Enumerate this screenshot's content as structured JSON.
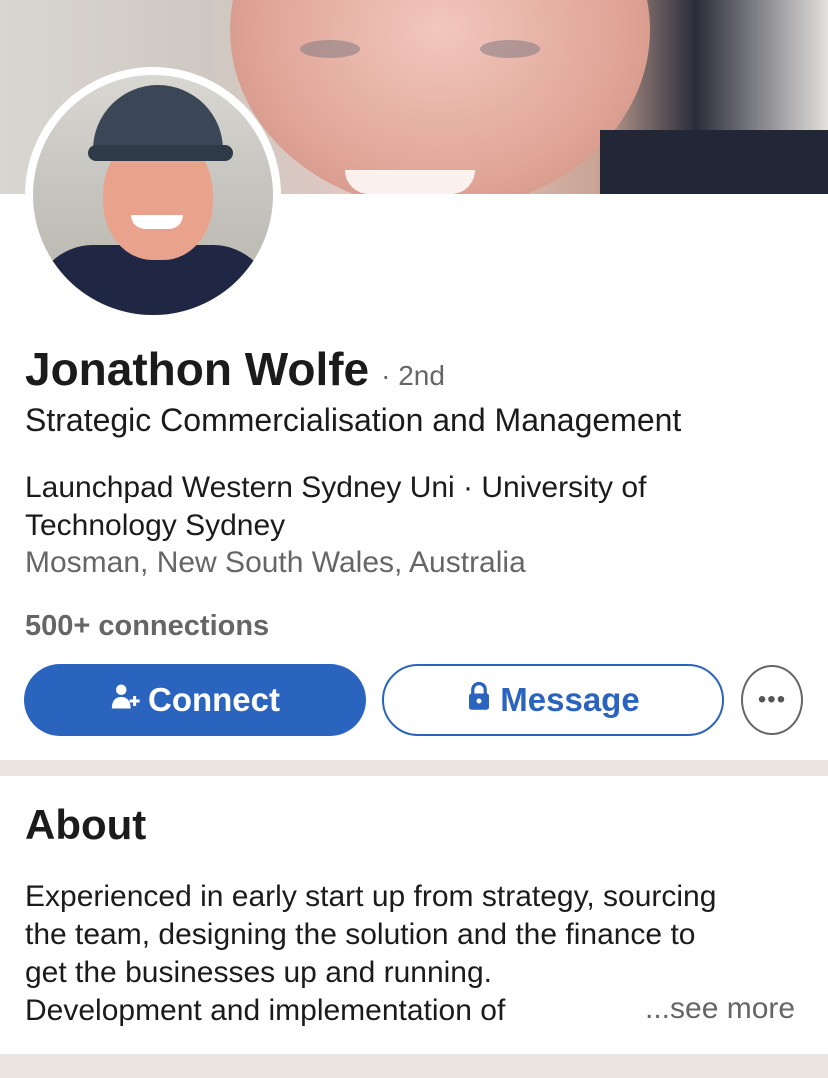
{
  "profile": {
    "name": "Jonathon Wolfe",
    "degree": "· 2nd",
    "headline": "Strategic Commercialisation and Management",
    "education": "Launchpad Western Sydney Uni · University of Technology Sydney",
    "location": "Mosman, New South Wales, Australia",
    "connections": "500+ connections"
  },
  "actions": {
    "connect_label": "Connect",
    "connect_icon": "add-person-icon",
    "message_label": "Message",
    "message_icon": "lock-icon",
    "more_icon": "more-dots-icon",
    "more_glyph": "•••"
  },
  "about": {
    "title": "About",
    "lines": [
      "Experienced in early start up from strategy, sourcing",
      "the team, designing the solution and the finance to",
      "get the businesses up and running.",
      "Development and implementation of"
    ],
    "see_more": "...see more"
  },
  "colors": {
    "accent": "#2a64be",
    "secondary_text": "#666666",
    "divider": "#eae6df"
  }
}
